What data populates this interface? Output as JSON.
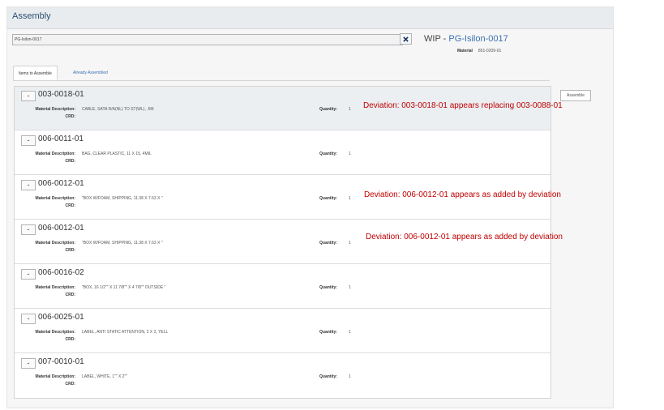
{
  "header": {
    "title": "Assembly"
  },
  "search": {
    "value": "PG-Isilon-0017"
  },
  "wip": {
    "label": "WIP - ",
    "link": "PG-Isilon-0017"
  },
  "material": {
    "label": "Material",
    "value": "851-0209-01"
  },
  "tabs": [
    {
      "label": "Items to Assemble",
      "active": true
    },
    {
      "label": "Already Assembled",
      "active": false
    }
  ],
  "assemble_button": "Assemble",
  "labels": {
    "toggle": "-",
    "material_description": "Material Description:",
    "crd": "CRD:",
    "quantity": "Quantity:"
  },
  "items": [
    {
      "part": "003-0018-01",
      "description": "CABLE, SATA R/A(NL) TO ST(WL), .5M",
      "crd": "",
      "quantity": "1"
    },
    {
      "part": "006-0011-01",
      "description": "BAG, CLEAR PLASTIC, 11 X 15, 4MIL",
      "crd": "",
      "quantity": "1"
    },
    {
      "part": "006-0012-01",
      "description": "\"BOX W/FOAM, SHIPPING, 11.38 X 7.63 X \"",
      "crd": "",
      "quantity": "1"
    },
    {
      "part": "006-0012-01",
      "description": "\"BOX W/FOAM, SHIPPING, 11.38 X 7.63 X \"",
      "crd": "",
      "quantity": "1"
    },
    {
      "part": "006-0016-02",
      "description": "\"BOX, 16 1/2\"\" X 11 7/8\"\" X 4 7/8\"\" OUTSIDE \"",
      "crd": "",
      "quantity": "1"
    },
    {
      "part": "006-0025-01",
      "description": "LABEL, ANTI STATIC ATTENTION, 2 X 2, YELL",
      "crd": "",
      "quantity": "1"
    },
    {
      "part": "007-0010-01",
      "description": "LABEL, WHITE, 1\"\" X 2\"\"",
      "crd": "",
      "quantity": "1"
    }
  ],
  "annotations": [
    "Deviation: 003-0018-01 appears replacing 003-0088-01",
    "Deviation: 006-0012-01 appears as added by deviation",
    "Deviation: 006-0012-01 appears as added by deviation"
  ],
  "colors": {
    "link": "#3a71b0",
    "title": "#2d4f74",
    "annotation": "#c00000",
    "highlight_row": "#eceff2"
  }
}
